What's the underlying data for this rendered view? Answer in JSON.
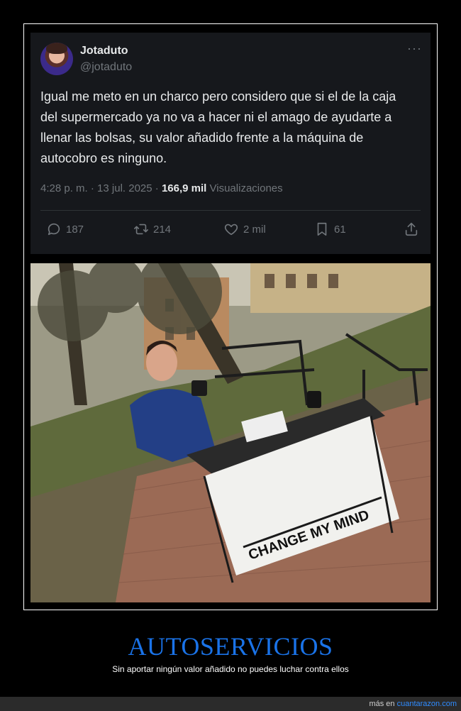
{
  "tweet": {
    "display_name": "Jotaduto",
    "handle": "@jotaduto",
    "more": "···",
    "text": "Igual me meto en un charco pero considero que si el de la caja del supermercado ya no va a hacer ni el amago de ayudarte a llenar las bolsas, su valor añadido frente a la máquina de autocobro es ninguno.",
    "time": "4:28 p. m.",
    "sep1": " · ",
    "date": "13 jul. 2025",
    "sep2": " · ",
    "views_count": "166,9 mil",
    "views_label": " Visualizaciones",
    "actions": {
      "replies": "187",
      "retweets": "214",
      "likes": "2 mil",
      "bookmarks": "61"
    }
  },
  "meme": {
    "sign_text": "CHANGE MY MIND"
  },
  "footer": {
    "title": "AUTOSERVICIOS",
    "subtitle": "Sin aportar ningún valor añadido no puedes luchar contra ellos",
    "more_prefix": "más en ",
    "site": "cuantarazon.com"
  }
}
